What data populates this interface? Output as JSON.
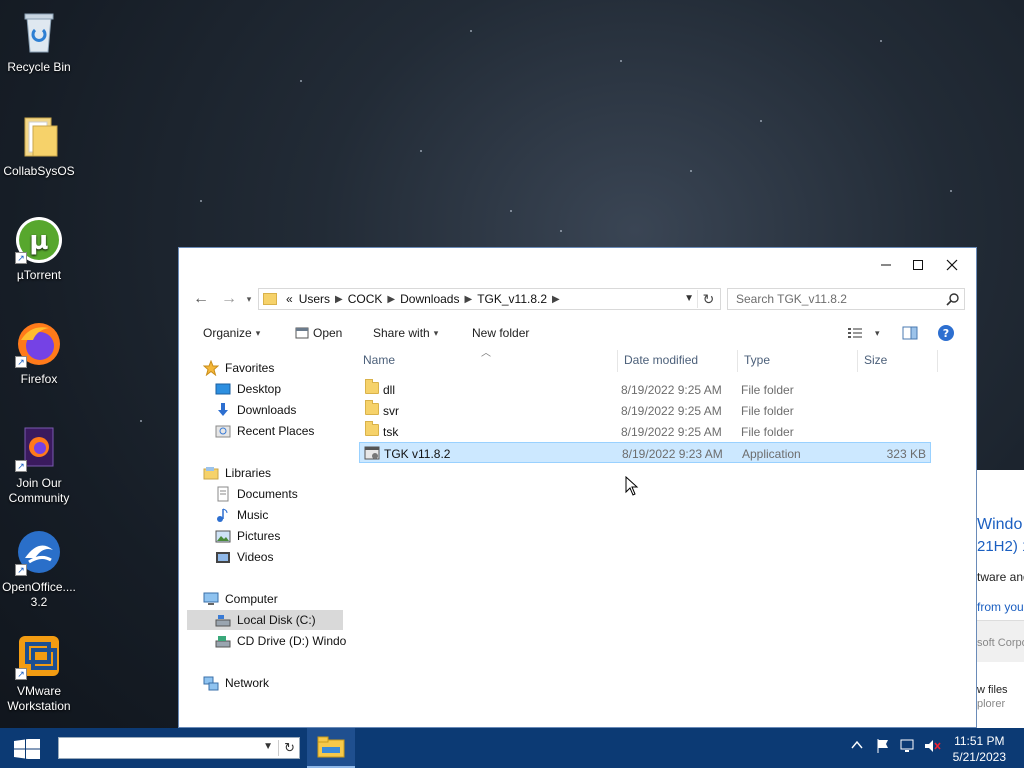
{
  "desktop": {
    "icons": [
      {
        "label": "Recycle Bin"
      },
      {
        "label": "CollabSysOS"
      },
      {
        "label": "µTorrent"
      },
      {
        "label": "Firefox"
      },
      {
        "label": "Join Our Community"
      },
      {
        "label": "OpenOffice.... 3.2"
      },
      {
        "label": "VMware Workstation"
      }
    ]
  },
  "background_window": {
    "lines": [
      "Windo",
      "21H2) 1",
      "tware and",
      "from you",
      "soft Corpo",
      "w files",
      "plorer"
    ]
  },
  "explorer": {
    "address": {
      "overflow": "«",
      "crumbs": [
        "Users",
        "COCK",
        "Downloads",
        "TGK_v11.8.2"
      ]
    },
    "search_placeholder": "Search TGK_v11.8.2",
    "toolbar": {
      "organize": "Organize",
      "open": "Open",
      "share_with": "Share with",
      "new_folder": "New folder"
    },
    "nav": {
      "favorites": "Favorites",
      "desktop": "Desktop",
      "downloads": "Downloads",
      "recent_places": "Recent Places",
      "libraries": "Libraries",
      "documents": "Documents",
      "music": "Music",
      "pictures": "Pictures",
      "videos": "Videos",
      "computer": "Computer",
      "local_disk": "Local Disk (C:)",
      "cd_drive": "CD Drive (D:) Windo",
      "network": "Network"
    },
    "columns": {
      "name": "Name",
      "date_modified": "Date modified",
      "type": "Type",
      "size": "Size"
    },
    "files": [
      {
        "name": "dll",
        "date": "8/19/2022 9:25 AM",
        "type": "File folder",
        "size": ""
      },
      {
        "name": "svr",
        "date": "8/19/2022 9:25 AM",
        "type": "File folder",
        "size": ""
      },
      {
        "name": "tsk",
        "date": "8/19/2022 9:25 AM",
        "type": "File folder",
        "size": ""
      },
      {
        "name": "TGK v11.8.2",
        "date": "8/19/2022 9:23 AM",
        "type": "Application",
        "size": "323 KB"
      }
    ]
  },
  "taskbar": {
    "search_value": "",
    "clock_time": "11:51 PM",
    "clock_date": "5/21/2023"
  },
  "colors": {
    "taskbar": "#0c3a74",
    "selection": "#cce8ff",
    "accent": "#1b5fc1"
  }
}
